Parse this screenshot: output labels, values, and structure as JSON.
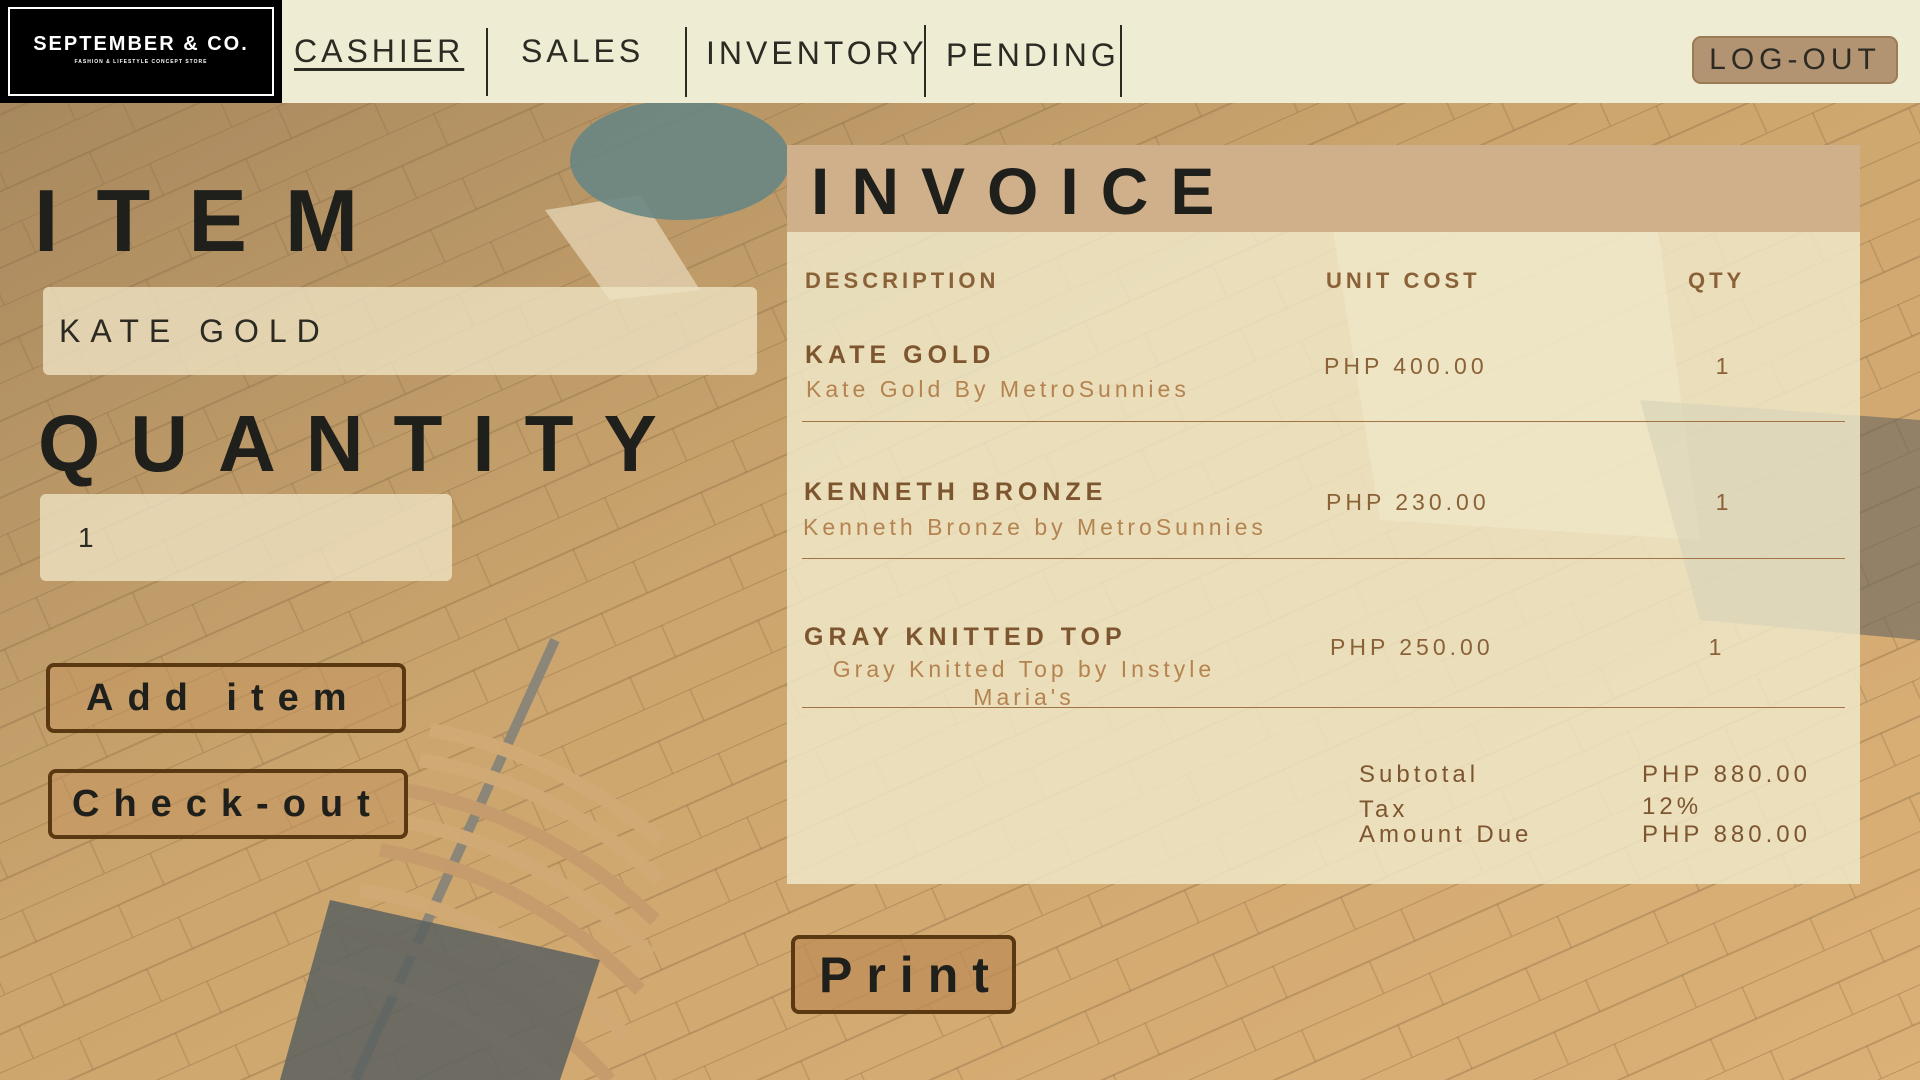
{
  "brand": {
    "name": "SEPTEMBER & CO.",
    "tagline": "FASHION & LIFESTYLE CONCEPT STORE"
  },
  "nav": {
    "tabs": [
      {
        "label": "CASHIER",
        "active": true
      },
      {
        "label": "SALES",
        "active": false
      },
      {
        "label": "INVENTORY",
        "active": false
      },
      {
        "label": "PENDING",
        "active": false
      }
    ],
    "logout_label": "LOG-OUT"
  },
  "form": {
    "item_label": "ITEM",
    "item_value": "KATE GOLD",
    "quantity_label": "QUANTITY",
    "quantity_value": "1",
    "add_label": "Add item",
    "checkout_label": "Check-out"
  },
  "invoice": {
    "title": "INVOICE",
    "columns": {
      "description": "DESCRIPTION",
      "unit_cost": "UNIT COST",
      "qty": "QTY"
    },
    "items": [
      {
        "name": "KATE GOLD",
        "description": "Kate Gold By MetroSunnies",
        "unit_cost": "PHP 400.00",
        "qty": "1"
      },
      {
        "name": "KENNETH BRONZE",
        "description": "Kenneth Bronze by MetroSunnies",
        "unit_cost": "PHP 230.00",
        "qty": "1"
      },
      {
        "name": "GRAY KNITTED TOP",
        "description": "Gray Knitted Top by Instyle Maria's",
        "unit_cost": "PHP 250.00",
        "qty": "1"
      }
    ],
    "totals": {
      "subtotal_label": "Subtotal",
      "subtotal_value": "PHP 880.00",
      "tax_label": "Tax",
      "tax_value": "12%",
      "amount_due_label": "Amount Due",
      "amount_due_value": "PHP 880.00"
    }
  },
  "print_label": "Print",
  "colors": {
    "nav_bg": "#eeecd2",
    "invoice_header": "#d0b08a",
    "accent_brown": "#5a3812",
    "text_dark": "#1f1f1c"
  }
}
